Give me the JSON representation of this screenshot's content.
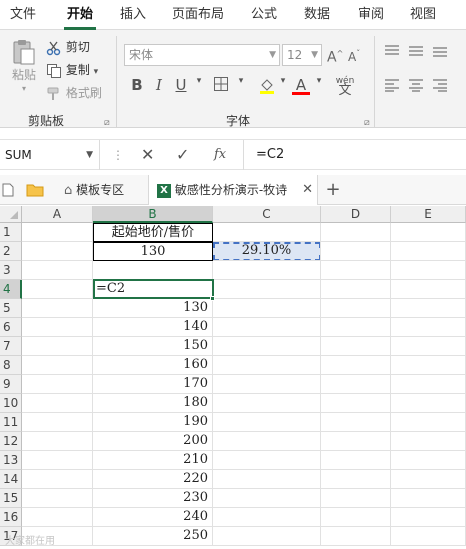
{
  "menu": {
    "items": [
      "文件",
      "开始",
      "插入",
      "页面布局",
      "公式",
      "数据",
      "审阅",
      "视图"
    ],
    "active_index": 1
  },
  "ribbon": {
    "clipboard": {
      "paste_label": "粘贴",
      "cut_label": "剪切",
      "copy_label": "复制",
      "format_painter_label": "格式刷",
      "group_label": "剪贴板"
    },
    "font": {
      "font_name": "宋体",
      "font_size": "12",
      "bold": "B",
      "italic": "I",
      "underline": "U",
      "grow": "A",
      "shrink": "A",
      "font_color_glyph": "A",
      "wen_glyph": "wén",
      "group_label": "字体"
    }
  },
  "formula_bar": {
    "name_box": "SUM",
    "fx_label": "fx",
    "formula": "=C2"
  },
  "tabs": {
    "template_tab": "模板专区",
    "file_tab": "敏感性分析演示-牧诗"
  },
  "sheet": {
    "columns": [
      "A",
      "B",
      "C",
      "D",
      "E"
    ],
    "rows": [
      "1",
      "2",
      "3",
      "4",
      "5",
      "6",
      "7",
      "8",
      "9",
      "10",
      "11",
      "12",
      "13",
      "14",
      "15",
      "16",
      "17"
    ],
    "b1_header": "起始地价/售价",
    "b2_value": "130",
    "c2_value": "29.10%",
    "b4_formula": "=C2",
    "b_values": [
      "130",
      "140",
      "150",
      "160",
      "170",
      "180",
      "190",
      "200",
      "210",
      "220",
      "230",
      "240",
      "250"
    ]
  },
  "watermark": "大家都在用",
  "colors": {
    "accent": "#217346",
    "selection_fill": "#dde6f4",
    "selection_border": "#4472c4"
  }
}
